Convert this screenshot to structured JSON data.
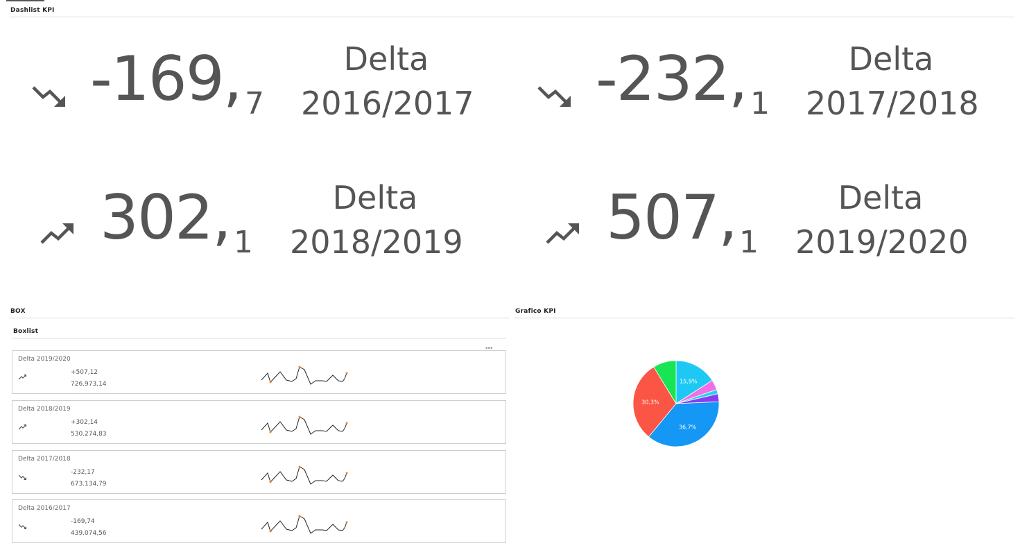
{
  "dashlist": {
    "title": "Dashlist KPI"
  },
  "kpis": [
    {
      "int": "-169,",
      "dec": "7",
      "label_line1": "Delta",
      "label_line2": "2016/2017",
      "trend": "down"
    },
    {
      "int": "-232,",
      "dec": "1",
      "label_line1": "Delta",
      "label_line2": "2017/2018",
      "trend": "down"
    },
    {
      "int": "302,",
      "dec": "1",
      "label_line1": "Delta",
      "label_line2": "2018/2019",
      "trend": "up"
    },
    {
      "int": "507,",
      "dec": "1",
      "label_line1": "Delta",
      "label_line2": "2019/2020",
      "trend": "up"
    }
  ],
  "box": {
    "title": "BOX",
    "subtitle": "Boxlist",
    "menu_icon": "more-dots-icon",
    "items": [
      {
        "title": "Delta 2019/2020",
        "delta": "+507,12",
        "total": "726.973,14",
        "trend": "up"
      },
      {
        "title": "Delta 2018/2019",
        "delta": "+302,14",
        "total": "530.274,83",
        "trend": "up"
      },
      {
        "title": "Delta 2017/2018",
        "delta": "-232,17",
        "total": "673.134,79",
        "trend": "down"
      },
      {
        "title": "Delta 2016/2017",
        "delta": "-169,74",
        "total": "439.074,56",
        "trend": "down"
      }
    ]
  },
  "grafico": {
    "title": "Grafico KPI"
  },
  "chart_data": {
    "type": "pie",
    "slices": [
      {
        "value": 15.9,
        "label": "15,9%",
        "color": "#1ec8f5"
      },
      {
        "value": 3.8,
        "label": "",
        "color": "#f26ee6"
      },
      {
        "value": 1.6,
        "label": "",
        "color": "#22d6f0"
      },
      {
        "value": 3.0,
        "label": "",
        "color": "#8a3df0"
      },
      {
        "value": 36.7,
        "label": "36,7%",
        "color": "#1597f5"
      },
      {
        "value": 30.3,
        "label": "30,3%",
        "color": "#fa5545"
      },
      {
        "value": 8.7,
        "label": "",
        "color": "#17e553"
      }
    ]
  },
  "colors": {
    "text": "#555555",
    "spark_line": "#222222",
    "spark_point": "#f08a24"
  }
}
